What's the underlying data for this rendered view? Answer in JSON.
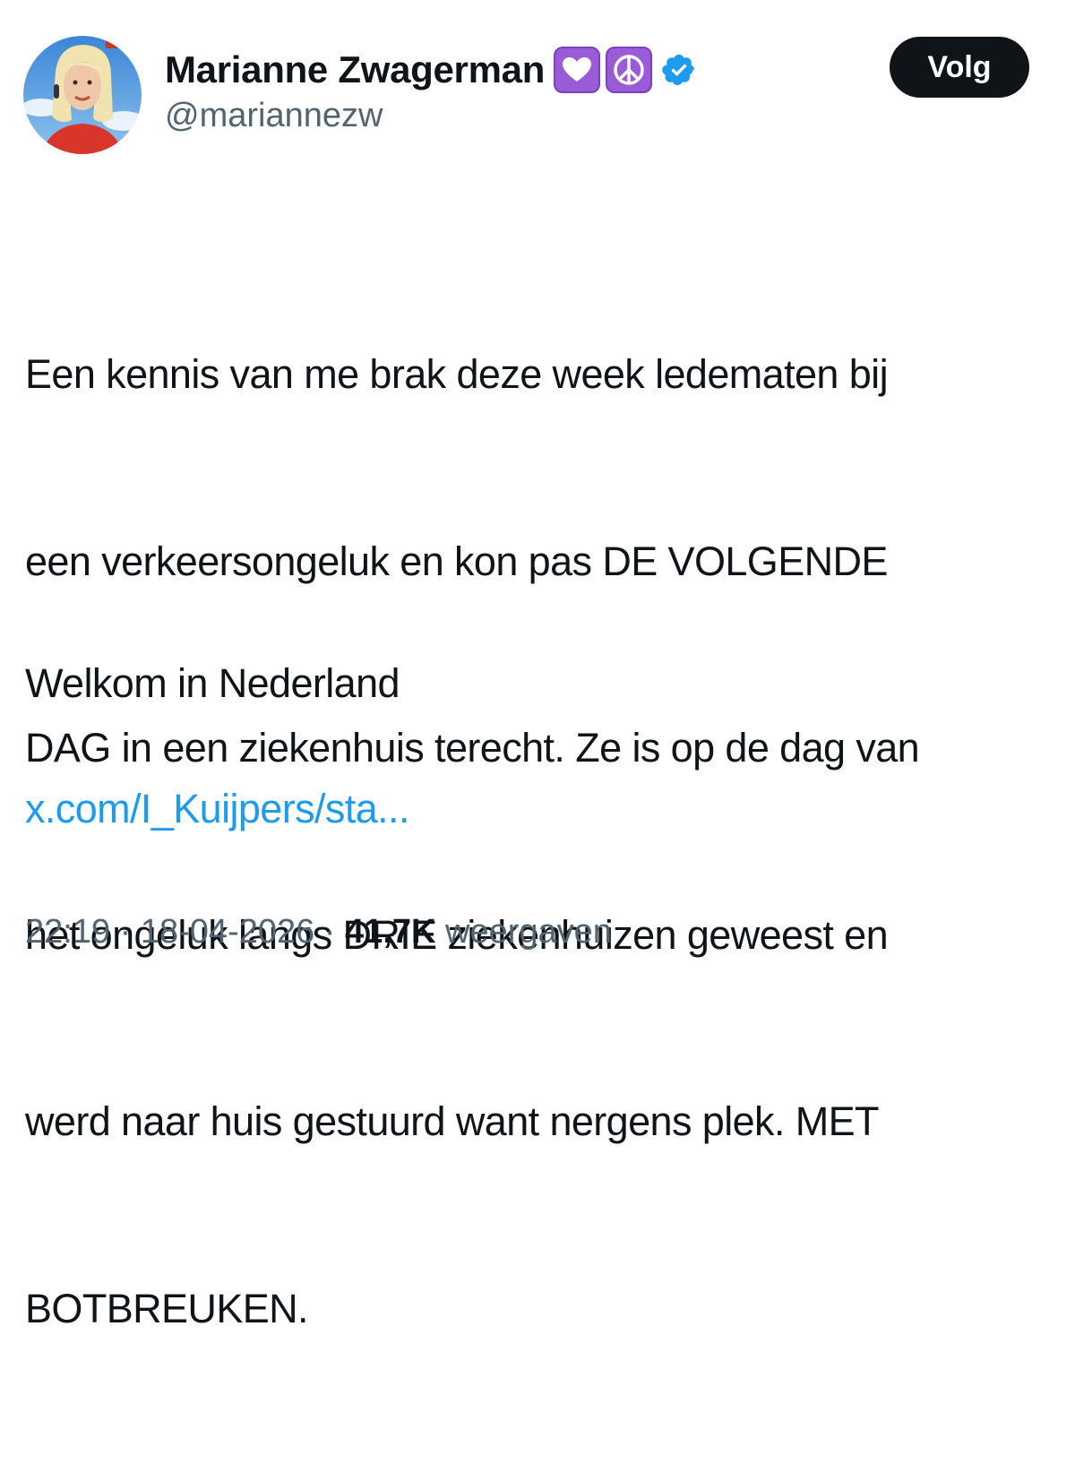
{
  "author": {
    "display_name": "Marianne Zwagerman",
    "handle": "@mariannezw",
    "badges": [
      "purple-heart-emoji",
      "peace-symbol-emoji",
      "verified-badge"
    ],
    "accent_color": "#1d9bf0",
    "emoji_box_color": "#9a5bd6"
  },
  "follow_button": {
    "label": "Volg"
  },
  "tweet": {
    "text_lines": [
      "Een kennis van me brak deze week ledematen bij",
      "een verkeersongeluk en kon pas DE VOLGENDE",
      "DAG in een ziekenhuis terecht. Ze is op de dag van",
      "het ongeluk langs DRIE ziekenhuizen geweest en",
      "werd naar huis gestuurd want nergens plek. MET",
      "BOTBREUKEN."
    ],
    "closing_line": "Welkom in Nederland",
    "link": "x.com/I_Kuijpers/sta..."
  },
  "meta": {
    "time": "22:19",
    "separator": "·",
    "date": "18-04-2026",
    "views_count": "41,7K",
    "views_label": "weergaven"
  }
}
